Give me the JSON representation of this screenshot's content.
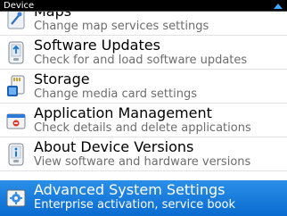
{
  "window": {
    "title": "Device"
  },
  "menu": {
    "items": [
      {
        "label": "Maps",
        "description": "Change map services settings",
        "icon": "maps-icon"
      },
      {
        "label": "Software Updates",
        "description": "Check for and load software updates",
        "icon": "software-updates-icon"
      },
      {
        "label": "Storage",
        "description": "Change media card settings",
        "icon": "storage-icon"
      },
      {
        "label": "Application Management",
        "description": "Check details and delete applications",
        "icon": "application-management-icon"
      },
      {
        "label": "About Device Versions",
        "description": "View software and hardware versions",
        "icon": "device-info-icon"
      },
      {
        "label": "Advanced System Settings",
        "description": "Enterprise activation, service book",
        "icon": "advanced-settings-icon",
        "selected": true
      }
    ]
  },
  "colors": {
    "selection": "#1a7de0",
    "title_bar": "#000000",
    "scroll_indicator": "#3fa7ff"
  }
}
